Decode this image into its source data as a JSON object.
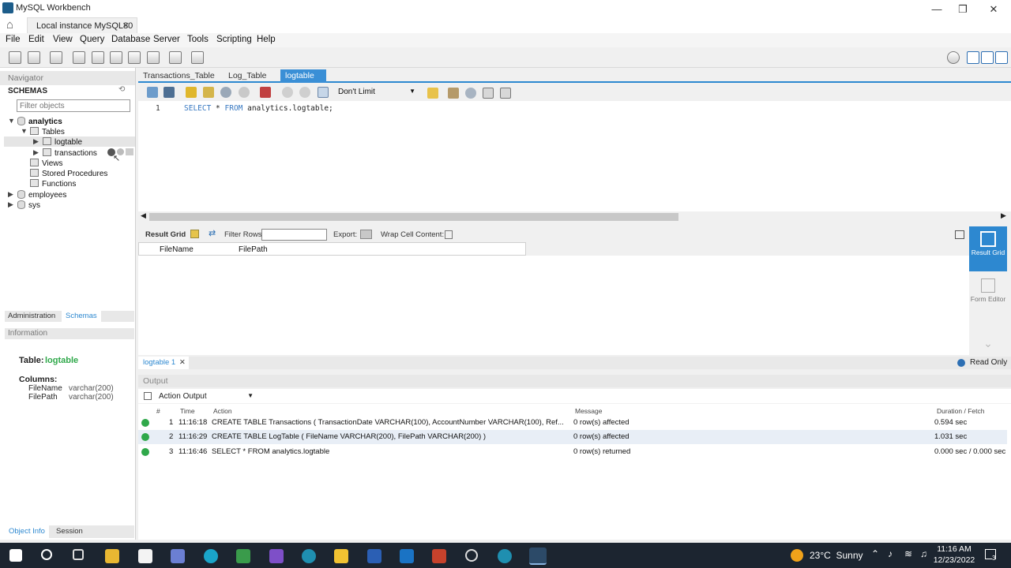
{
  "window": {
    "title": "MySQL Workbench",
    "controls": [
      "—",
      "❐",
      "✕"
    ]
  },
  "connection_tab": {
    "label": "Local instance MySQL80",
    "close": "✕"
  },
  "menu": [
    "File",
    "Edit",
    "View",
    "Query",
    "Database",
    "Server",
    "Tools",
    "Scripting",
    "Help"
  ],
  "navigator": {
    "header": "Navigator",
    "schemas_label": "SCHEMAS",
    "filter_placeholder": "Filter objects",
    "tree": {
      "analytics": "analytics",
      "tables": "Tables",
      "logtable": "logtable",
      "transactions": "transactions",
      "views": "Views",
      "procedures": "Stored Procedures",
      "functions": "Functions",
      "employees": "employees",
      "sys": "sys"
    },
    "bottom_tabs": [
      "Administration",
      "Schemas"
    ],
    "information_header": "Information",
    "info": {
      "table_label": "Table:",
      "table_name": "logtable",
      "columns_label": "Columns:",
      "columns": [
        {
          "name": "FileName",
          "type": "varchar(200)"
        },
        {
          "name": "FilePath",
          "type": "varchar(200)"
        }
      ]
    },
    "footer_tabs": [
      "Object Info",
      "Session"
    ]
  },
  "sql_tabs": [
    "Transactions_Table",
    "Log_Table",
    "logtable"
  ],
  "sql_tab_close": "✕",
  "limit": {
    "label": "Don't Limit"
  },
  "editor": {
    "line": "1",
    "kw1": "SELECT",
    "rest1": " * ",
    "kw2": "FROM",
    "rest2": " analytics.logtable;"
  },
  "result": {
    "grid_label": "Result Grid",
    "filter_label": "Filter Rows:",
    "export_label": "Export:",
    "wrap_label": "Wrap Cell Content:",
    "columns": [
      "FileName",
      "FilePath"
    ]
  },
  "right_panel": {
    "result_grid": "Result Grid",
    "form_editor": "Form Editor"
  },
  "result_tab": {
    "label": "logtable 1",
    "close": "✕",
    "read_only": "Read Only"
  },
  "output": {
    "header": "Output",
    "selector": "Action Output",
    "columns": {
      "num": "#",
      "time": "Time",
      "action": "Action",
      "message": "Message",
      "duration": "Duration / Fetch"
    },
    "rows": [
      {
        "num": "1",
        "time": "11:16:18",
        "action": "CREATE TABLE Transactions (     TransactionDate VARCHAR(100),     AccountNumber VARCHAR(100),     Ref...",
        "message": "0 row(s) affected",
        "duration": "0.594 sec"
      },
      {
        "num": "2",
        "time": "11:16:29",
        "action": "CREATE TABLE LogTable (     FileName VARCHAR(200),     FilePath VARCHAR(200) )",
        "message": "0 row(s) affected",
        "duration": "1.031 sec"
      },
      {
        "num": "3",
        "time": "11:16:46",
        "action": "SELECT * FROM analytics.logtable",
        "message": "0 row(s) returned",
        "duration": "0.000 sec / 0.000 sec"
      }
    ]
  },
  "taskbar": {
    "weather": "23°C  Sunny",
    "time": "11:16 AM",
    "date": "12/23/2022",
    "notif": "3"
  },
  "colors": {
    "accent": "#3a8fd6",
    "ok": "#2fa84a",
    "taskbar": "#1c2530"
  }
}
